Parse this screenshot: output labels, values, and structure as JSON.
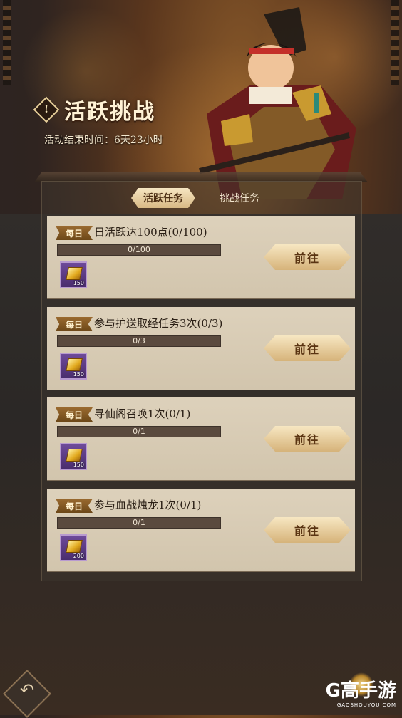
{
  "header": {
    "title": "活跃挑战",
    "title_icon": "!",
    "subtitle": "活动结束时间：6天23小时"
  },
  "tabs": [
    {
      "label": "活跃任务",
      "active": true
    },
    {
      "label": "挑战任务",
      "active": false
    }
  ],
  "tasks": [
    {
      "badge": "每日",
      "text": "日活跃达100点(0/100)",
      "progress_text": "0/100",
      "progress": 0,
      "reward_count": "150",
      "button": "前往"
    },
    {
      "badge": "每日",
      "text": "参与护送取经任务3次(0/3)",
      "progress_text": "0/3",
      "progress": 0,
      "reward_count": "150",
      "button": "前往"
    },
    {
      "badge": "每日",
      "text": "寻仙阁召唤1次(0/1)",
      "progress_text": "0/1",
      "progress": 0,
      "reward_count": "150",
      "button": "前往"
    },
    {
      "badge": "每日",
      "text": "参与血战烛龙1次(0/1)",
      "progress_text": "0/1",
      "progress": 0,
      "reward_count": "200",
      "button": "前往"
    }
  ],
  "footer": {
    "back_icon": "back-arrow-icon",
    "watermark_logo": "G高手游",
    "watermark_url": "GAOSHOUYOU.COM"
  },
  "colors": {
    "card_bg": "#d8ccb4",
    "button_gold": "#e8cf9c",
    "badge_brown": "#7d5322",
    "title_cream": "#fff3d6"
  }
}
